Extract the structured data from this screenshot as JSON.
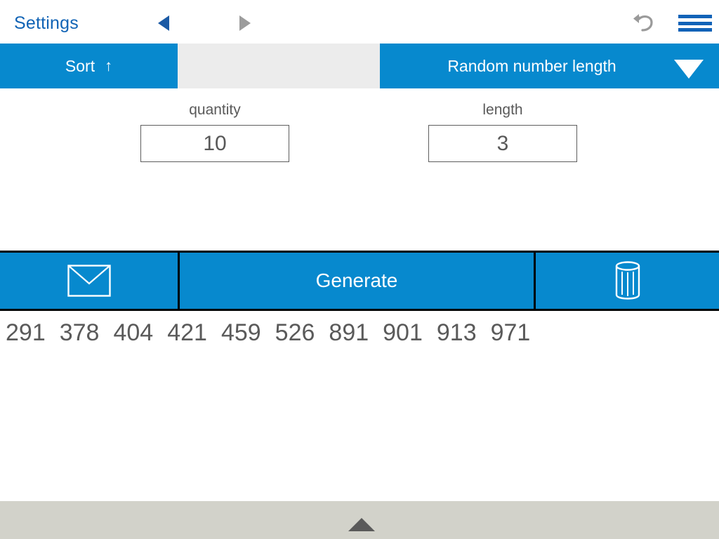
{
  "header": {
    "title": "Settings",
    "title_color": "#1063b5",
    "prev_arrow": "left-triangle",
    "next_arrow": "right-triangle",
    "undo_icon": "undo-arrow",
    "menu_icon": "hamburger-menu"
  },
  "toolbar": {
    "sort_label": "Sort",
    "sort_arrow": "↑",
    "dropdown_label": "Random number length",
    "dropdown_caret": "▼",
    "accent_color": "#0789ce",
    "gap_color": "#ececec"
  },
  "fields": {
    "quantity": {
      "label": "quantity",
      "value": "10"
    },
    "length": {
      "label": "length",
      "value": "3"
    }
  },
  "actions": {
    "mail_icon": "envelope-icon",
    "generate_label": "Generate",
    "trash_icon": "trash-icon"
  },
  "results": {
    "numbers": [
      "291",
      "378",
      "404",
      "421",
      "459",
      "526",
      "891",
      "901",
      "913",
      "971"
    ],
    "text_color": "#5a5a5a"
  },
  "bottom_bar": {
    "caret_icon": "up-triangle",
    "background": "#d2d2ca"
  }
}
